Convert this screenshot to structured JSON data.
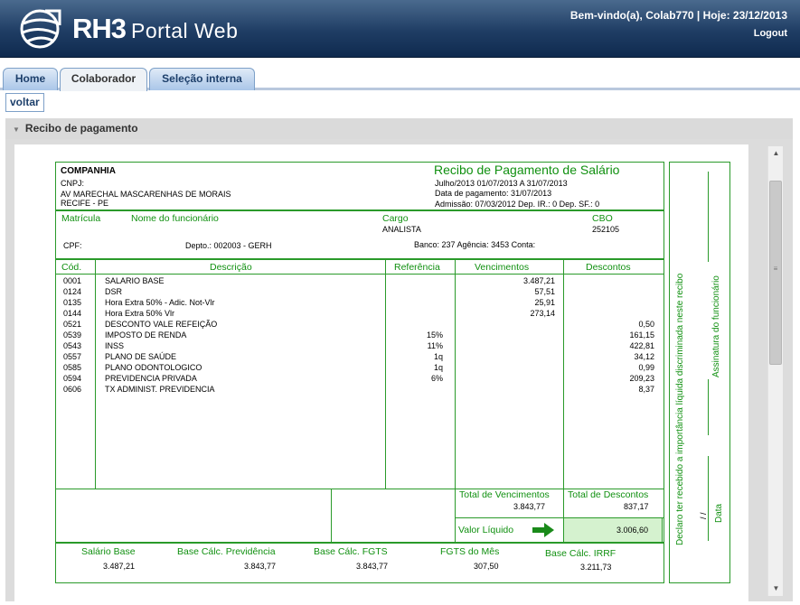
{
  "header": {
    "brand_main": "RH3",
    "brand_sub": "Portal Web",
    "welcome": "Bem-vindo(a), Colab770 | Hoje: 23/12/2013",
    "logout": "Logout"
  },
  "tabs": [
    "Home",
    "Colaborador",
    "Seleção interna"
  ],
  "voltar": "voltar",
  "panel_title": "Recibo de pagamento",
  "receipt": {
    "company_label": "COMPANHIA",
    "cnpj_label": "CNPJ:",
    "address1": "AV MARECHAL MASCARENHAS DE MORAIS",
    "address2": "RECIFE - PE",
    "title": "Recibo de Pagamento de Salário",
    "period": "Julho/2013   01/07/2013  A  31/07/2013",
    "pay_date": "Data de pagamento: 31/07/2013",
    "admission": "Admissão: 07/03/2012   Dep. IR.: 0   Dep. SF.: 0",
    "matricula_label": "Matrícula",
    "nome_label": "Nome do funcionário",
    "cargo_label": "Cargo",
    "cargo_value": "ANALISTA",
    "cbo_label": "CBO",
    "cbo_value": "252105",
    "cpf_label": "CPF:",
    "depto": "Depto.: 002003 - GERH",
    "banco": "Banco: 237  Agência: 3453  Conta:",
    "headers": [
      "Cód.",
      "Descrição",
      "Referência",
      "Vencimentos",
      "Descontos"
    ],
    "items": [
      {
        "cod": "0001",
        "desc": "SALARIO BASE",
        "ref": "",
        "venc": "3.487,21",
        "desc_v": ""
      },
      {
        "cod": "0124",
        "desc": "DSR",
        "ref": "",
        "venc": "57,51",
        "desc_v": ""
      },
      {
        "cod": "0135",
        "desc": "Hora Extra 50% - Adic. Not-Vlr",
        "ref": "",
        "venc": "25,91",
        "desc_v": ""
      },
      {
        "cod": "0144",
        "desc": "Hora Extra 50% Vlr",
        "ref": "",
        "venc": "273,14",
        "desc_v": ""
      },
      {
        "cod": "0521",
        "desc": "DESCONTO VALE REFEIÇÃO",
        "ref": "",
        "venc": "",
        "desc_v": "0,50"
      },
      {
        "cod": "0539",
        "desc": "IMPOSTO DE RENDA",
        "ref": "15%",
        "venc": "",
        "desc_v": "161,15"
      },
      {
        "cod": "0543",
        "desc": "INSS",
        "ref": "11%",
        "venc": "",
        "desc_v": "422,81"
      },
      {
        "cod": "0557",
        "desc": "PLANO DE SAÚDE",
        "ref": "1q",
        "venc": "",
        "desc_v": "34,12"
      },
      {
        "cod": "0585",
        "desc": "PLANO ODONTOLOGICO",
        "ref": "1q",
        "venc": "",
        "desc_v": "0,99"
      },
      {
        "cod": "0594",
        "desc": "PREVIDENCIA PRIVADA",
        "ref": "6%",
        "venc": "",
        "desc_v": "209,23"
      },
      {
        "cod": "0606",
        "desc": "TX ADMINIST. PREVIDENCIA",
        "ref": "",
        "venc": "",
        "desc_v": "8,37"
      }
    ],
    "total_venc_label": "Total de Vencimentos",
    "total_venc": "3.843,77",
    "total_desc_label": "Total de Descontos",
    "total_desc": "837,17",
    "liquido_label": "Valor Líquido",
    "liquido": "3.006,60",
    "footer": [
      {
        "label": "Salário Base",
        "value": "3.487,21"
      },
      {
        "label": "Base Cálc. Previdência",
        "value": "3.843,77"
      },
      {
        "label": "Base Cálc. FGTS",
        "value": "3.843,77"
      },
      {
        "label": "FGTS do Mês",
        "value": "307,50"
      },
      {
        "label": "Base Cálc. IRRF",
        "value": "3.211,73"
      }
    ],
    "declaro": "Declaro ter recebido a importância líquida discriminada neste recibo",
    "assinatura": "Assinatura do funcionário",
    "data_label": "Data",
    "date_slashes": "/      /"
  }
}
